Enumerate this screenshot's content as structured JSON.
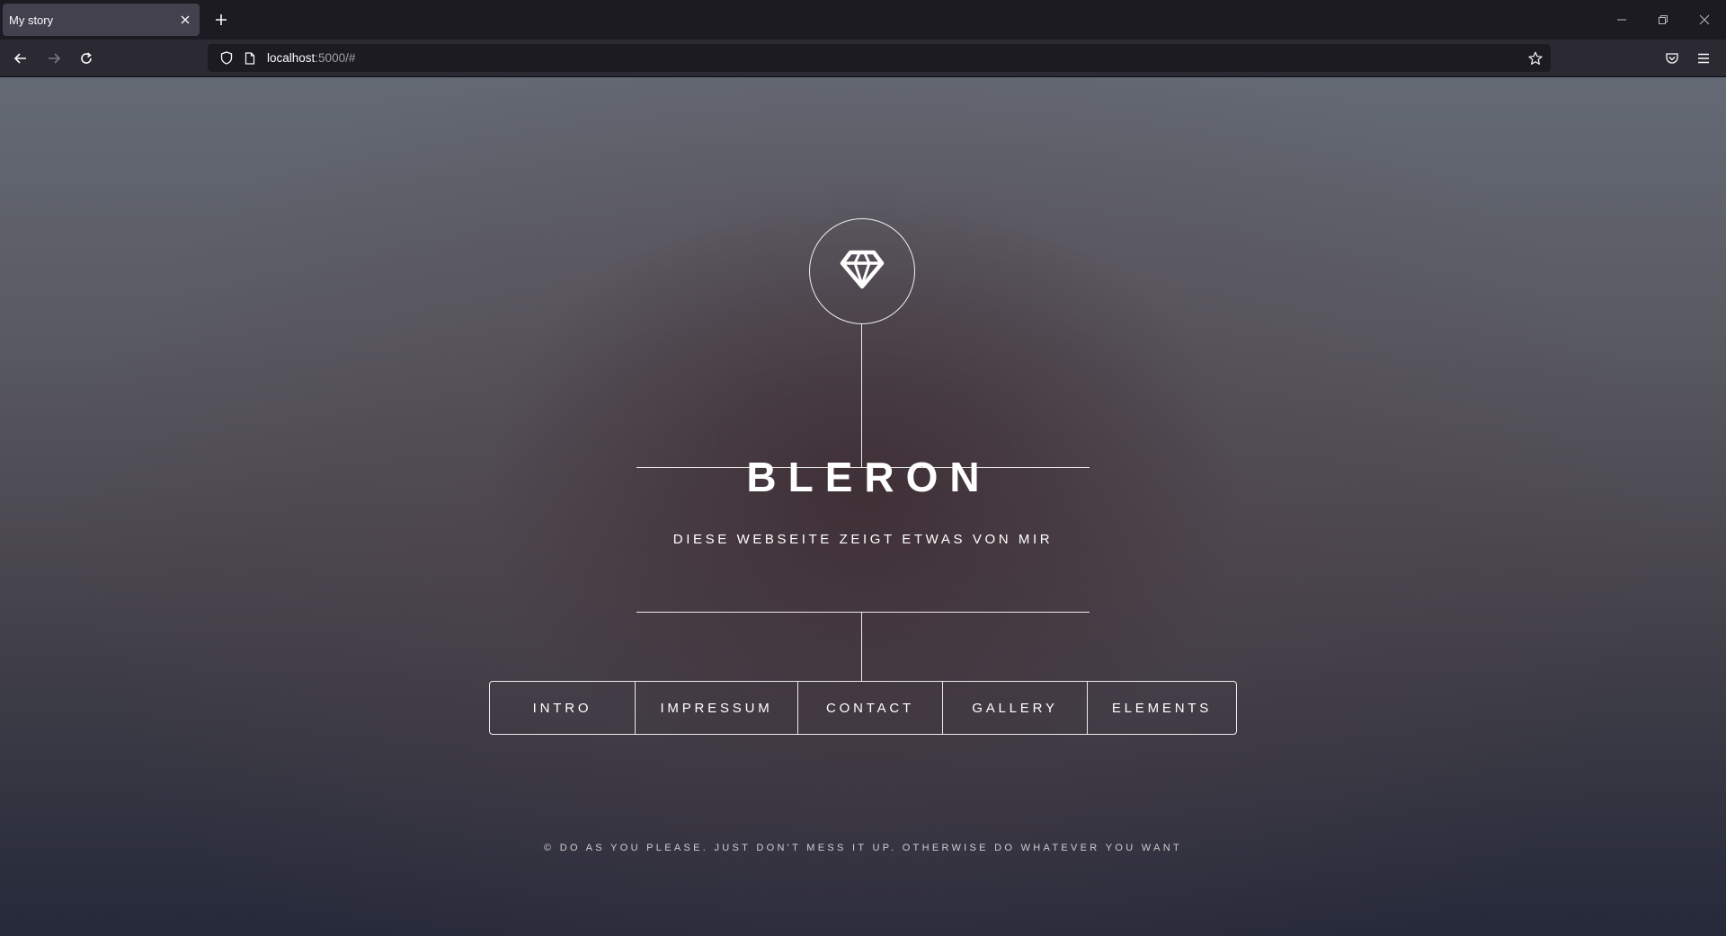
{
  "browser": {
    "tab_title": "My story",
    "url_host": "localhost",
    "url_rest": ":5000/#"
  },
  "icons": {
    "logo": "diamond-icon",
    "back": "arrow-left-icon",
    "forward": "arrow-right-icon",
    "reload": "reload-icon",
    "shield": "shield-icon",
    "page": "page-icon",
    "bookmark": "star-icon",
    "pocket": "pocket-icon",
    "menu": "hamburger-menu-icon"
  },
  "site": {
    "title": "BLERON",
    "subtitle": "DIESE WEBSEITE ZEIGT ETWAS VON MIR",
    "nav": [
      "INTRO",
      "IMPRESSUM",
      "CONTACT",
      "GALLERY",
      "ELEMENTS"
    ],
    "footer": "© DO AS YOU PLEASE. JUST DON'T MESS IT UP. OTHERWISE DO WHATEVER YOU WANT"
  }
}
